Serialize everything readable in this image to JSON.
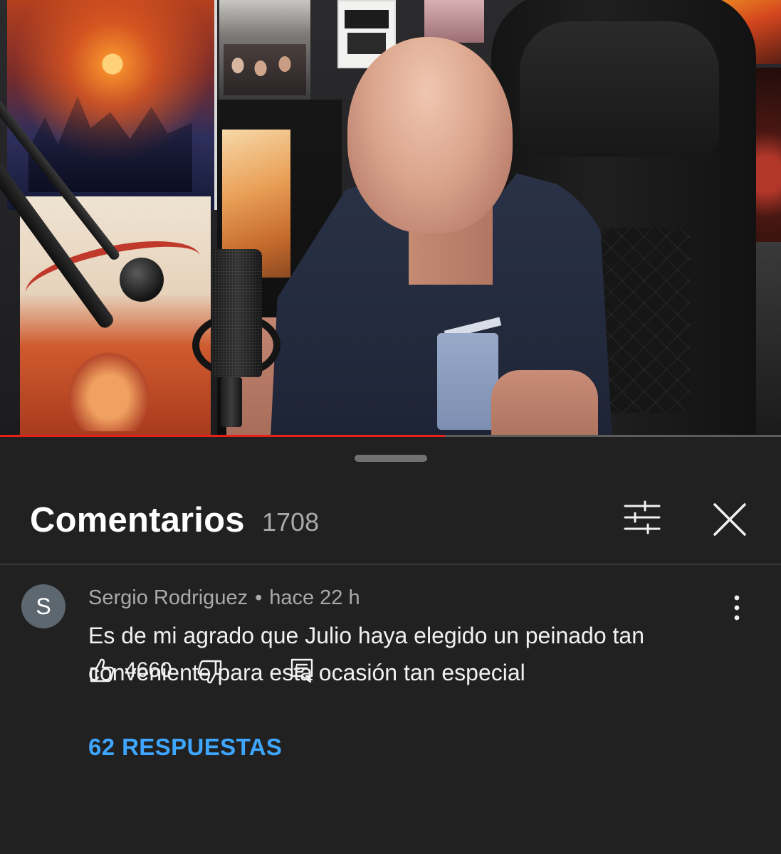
{
  "video": {
    "progress_fraction": 0.57,
    "progress_color": "#e62117"
  },
  "comments_sheet": {
    "title": "Comentarios",
    "count": "1708",
    "filter_icon": "sort-filter-icon",
    "close_icon": "close-icon"
  },
  "comment": {
    "avatar_letter": "S",
    "author": "Sergio Rodriguez",
    "separator": "•",
    "time": "hace 22 h",
    "text": "Es de mi agrado que Julio haya elegido un peinado tan conveniente para esta ocasión tan especial",
    "likes": "4660",
    "replies_label": "62 RESPUESTAS",
    "replies_color": "#3ea6ff"
  }
}
